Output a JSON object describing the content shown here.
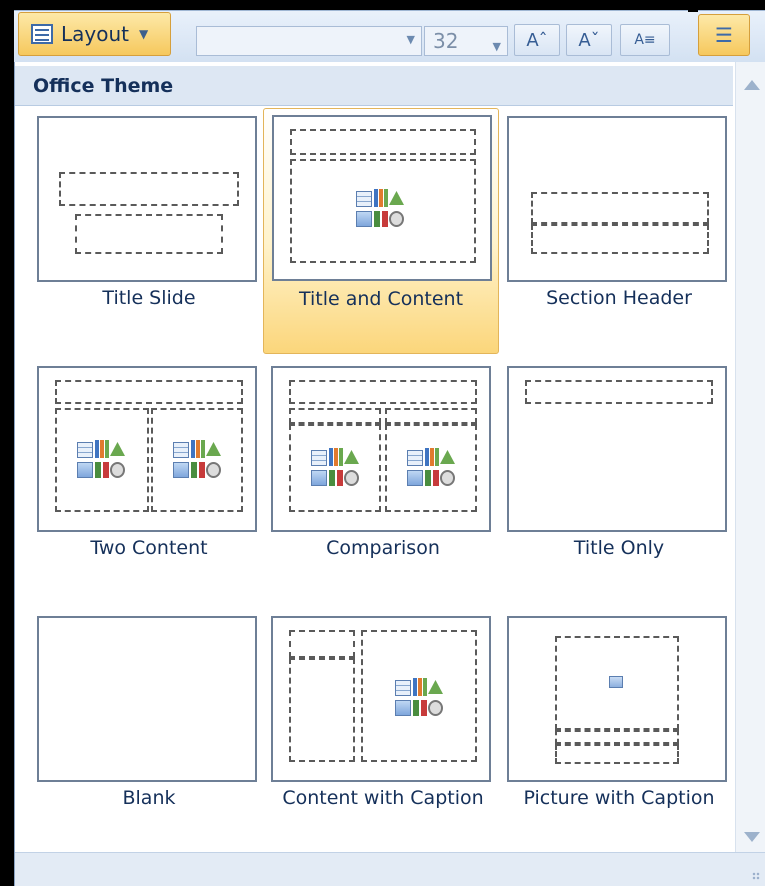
{
  "ribbon": {
    "layout_label": "Layout",
    "font_size": "32",
    "grow_font_label": "Aˆ",
    "shrink_font_label": "Aˇ",
    "clear_format_label": "A≡",
    "bullets_label": "☰"
  },
  "gallery": {
    "section_title": "Office Theme",
    "layouts": [
      {
        "name": "Title Slide"
      },
      {
        "name": "Title and Content",
        "selected": true
      },
      {
        "name": "Section Header"
      },
      {
        "name": "Two Content"
      },
      {
        "name": "Comparison"
      },
      {
        "name": "Title Only"
      },
      {
        "name": "Blank"
      },
      {
        "name": "Content with Caption"
      },
      {
        "name": "Picture with Caption"
      }
    ]
  },
  "colors": {
    "accent_gold": "#f6c85d",
    "header_bg": "#dde7f3",
    "text_navy": "#15305a"
  },
  "icons": {
    "layout": "layout-icon",
    "content": "content-placeholder-icon",
    "picture": "picture-placeholder-icon"
  }
}
